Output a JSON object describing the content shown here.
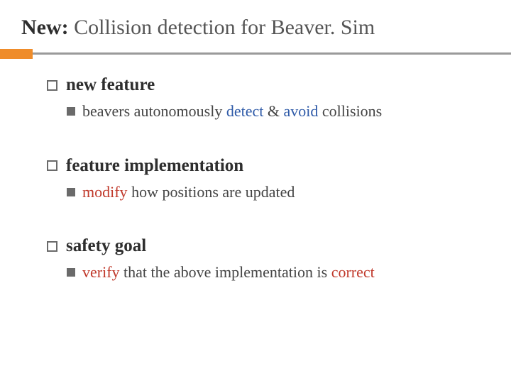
{
  "title": {
    "new_label": "New:",
    "rest": " Collision detection for Beaver. Sim"
  },
  "sections": [
    {
      "head": "new feature",
      "sub_pre": "beavers autonomously ",
      "sub_hl1": "detect",
      "sub_mid": " & ",
      "sub_hl2": "avoid",
      "sub_post": " collisions",
      "hl1_class": "hl-blue",
      "hl2_class": "hl-blue"
    },
    {
      "head": "feature implementation",
      "sub_pre": "",
      "sub_hl1": "modify",
      "sub_mid": " how positions are updated",
      "sub_hl2": "",
      "sub_post": "",
      "hl1_class": "hl-red",
      "hl2_class": ""
    },
    {
      "head": "safety goal",
      "sub_pre": "",
      "sub_hl1": "verify",
      "sub_mid": " that the above implementation is ",
      "sub_hl2": "correct",
      "sub_post": "",
      "hl1_class": "hl-red",
      "hl2_class": "hl-red"
    }
  ]
}
